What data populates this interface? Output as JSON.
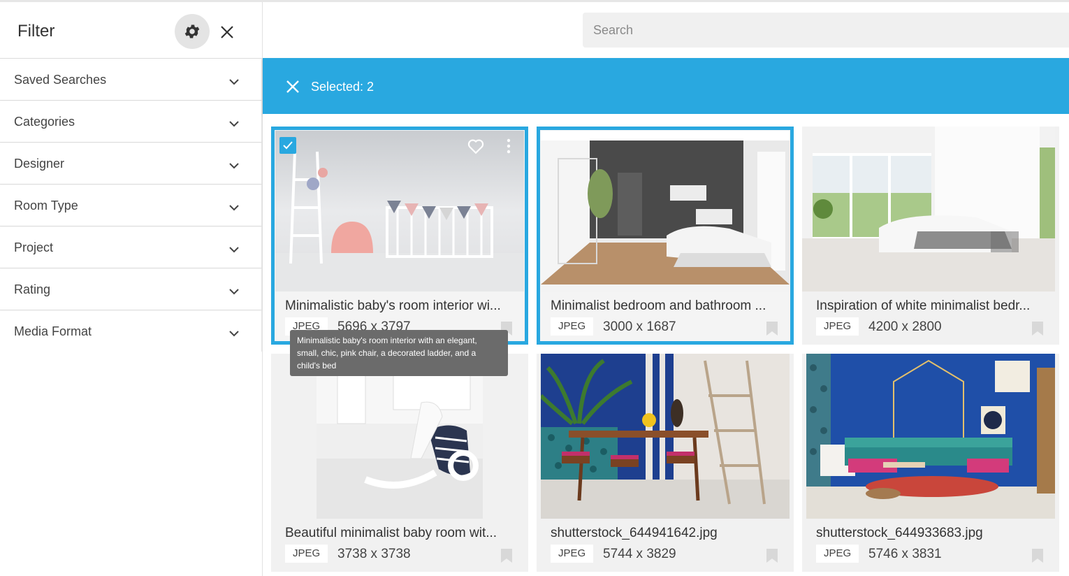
{
  "sidebar": {
    "title": "Filter",
    "filters": [
      {
        "label": "Saved Searches"
      },
      {
        "label": "Categories"
      },
      {
        "label": "Designer"
      },
      {
        "label": "Room Type"
      },
      {
        "label": "Project"
      },
      {
        "label": "Rating"
      },
      {
        "label": "Media Format"
      }
    ]
  },
  "search": {
    "placeholder": "Search"
  },
  "selection": {
    "text": "Selected: 2"
  },
  "colors": {
    "accent": "#29a8e0"
  },
  "cards": [
    {
      "title": "Minimalistic baby's room interior wi...",
      "format": "JPEG",
      "dims": "5696 x 3797",
      "selected": true
    },
    {
      "title": "Minimalist bedroom and bathroom ...",
      "format": "JPEG",
      "dims": "3000 x 1687",
      "selected": true
    },
    {
      "title": "Inspiration of white minimalist bedr...",
      "format": "JPEG",
      "dims": "4200 x 2800",
      "selected": false
    },
    {
      "title": "Beautiful minimalist baby room wit...",
      "format": "JPEG",
      "dims": "3738 x 3738",
      "selected": false
    },
    {
      "title": "shutterstock_644941642.jpg",
      "format": "JPEG",
      "dims": "5744 x 3829",
      "selected": false
    },
    {
      "title": "shutterstock_644933683.jpg",
      "format": "JPEG",
      "dims": "5746 x 3831",
      "selected": false
    }
  ],
  "tooltip": {
    "text": "Minimalistic baby's room interior with an elegant, small, chic, pink chair, a decorated ladder, and a child's bed"
  },
  "icons": [
    "gear-icon",
    "close-icon",
    "chevron-down-icon",
    "check-icon",
    "heart-icon",
    "more-vert-icon",
    "bookmark-icon"
  ]
}
